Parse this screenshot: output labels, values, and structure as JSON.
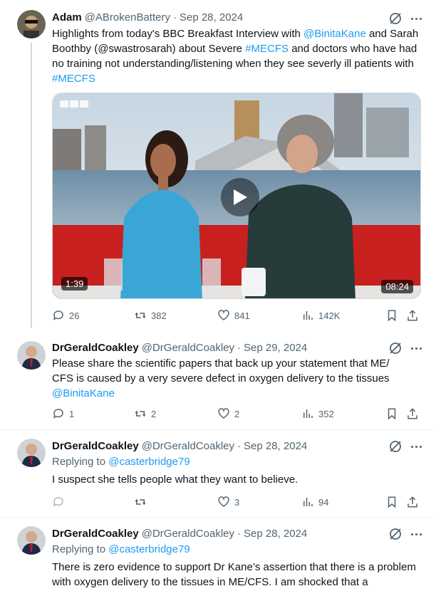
{
  "tweets": [
    {
      "name": "Adam",
      "handle": "@ABrokenBattery",
      "date": "Sep 28, 2024",
      "text": {
        "p1": "Highlights from today's BBC Breakfast Interview with ",
        "m1": "@BinitaKane",
        "p2": " and Sarah Boothby (@swastrosarah) about Severe ",
        "m2": "#MECFS",
        "p3": " and doctors who have had no training not understanding/listening when they see  severly ill patients with ",
        "m3": "#MECFS"
      },
      "video": {
        "channel_logo": "BBC",
        "left_duration": "1:39",
        "right_duration": "08:24"
      },
      "stats": {
        "replies": "26",
        "reposts": "382",
        "likes": "841",
        "views": "142K"
      }
    },
    {
      "name": "DrGeraldCoakley",
      "handle": "@DrGeraldCoakley",
      "date": "Sep 29, 2024",
      "text": {
        "p1": "Please share the scientific papers that back up your statement that ME/ CFS is caused by a very severe defect in oxygen delivery to the tissues ",
        "m1": "@BinitaKane"
      },
      "stats": {
        "replies": "1",
        "reposts": "2",
        "likes": "2",
        "views": "352"
      }
    },
    {
      "name": "DrGeraldCoakley",
      "handle": "@DrGeraldCoakley",
      "date": "Sep 28, 2024",
      "replying_prefix": "Replying to ",
      "replying_to": "@casterbridge79",
      "text": {
        "p1": "I suspect she tells people what they want to believe."
      },
      "stats": {
        "replies": "",
        "reposts": "",
        "likes": "3",
        "views": "94"
      }
    },
    {
      "name": "DrGeraldCoakley",
      "handle": "@DrGeraldCoakley",
      "date": "Sep 28, 2024",
      "replying_prefix": "Replying to ",
      "replying_to": "@casterbridge79",
      "text": {
        "p1": "There is zero evidence to support Dr  Kane’s assertion that there is a problem with oxygen delivery to the tissues in ME/CFS. I am shocked that a"
      }
    }
  ],
  "icons": [
    "grok-icon",
    "more-icon",
    "reply-icon",
    "repost-icon",
    "like-icon",
    "views-icon",
    "bookmark-icon",
    "share-icon",
    "play-icon"
  ],
  "colors": {
    "link": "#1d9bf0",
    "secondary": "#536471",
    "divider": "#eff3f4",
    "thread_line": "#cfd9de"
  }
}
